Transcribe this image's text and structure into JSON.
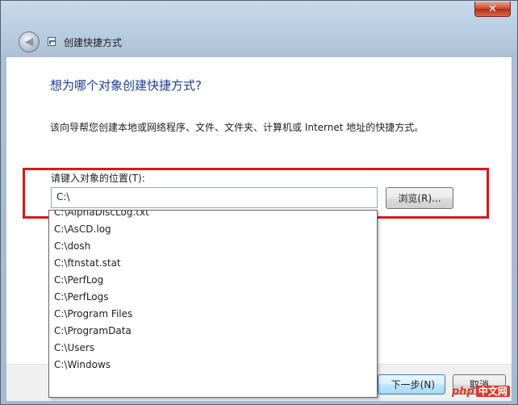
{
  "window": {
    "title": "创建快捷方式",
    "close_label": "✕",
    "back_icon": "back-arrow-icon"
  },
  "main": {
    "heading": "想为哪个对象创建快捷方式?",
    "description": "该向导帮您创建本地或网络程序、文件、文件夹、计算机或 Internet 地址的快捷方式。",
    "location_label": "请键入对象的位置(T):",
    "location_value": "C:\\",
    "browse_label": "浏览(R)..."
  },
  "dropdown": {
    "items": [
      "C:\\AlphaDiscLog.txt",
      "C:\\AsCD.log",
      "C:\\dosh",
      "C:\\ftnstat.stat",
      "C:\\PerfLog",
      "C:\\PerfLogs",
      "C:\\Program Files",
      "C:\\ProgramData",
      "C:\\Users",
      "C:\\Windows"
    ]
  },
  "footer": {
    "next_label": "下一步(N)",
    "cancel_label": "取消"
  },
  "watermark": {
    "prefix": "php",
    "suffix": "中文网"
  },
  "colors": {
    "heading": "#1c3c8c",
    "highlight": "#d8171f",
    "close": "#c7462d"
  }
}
